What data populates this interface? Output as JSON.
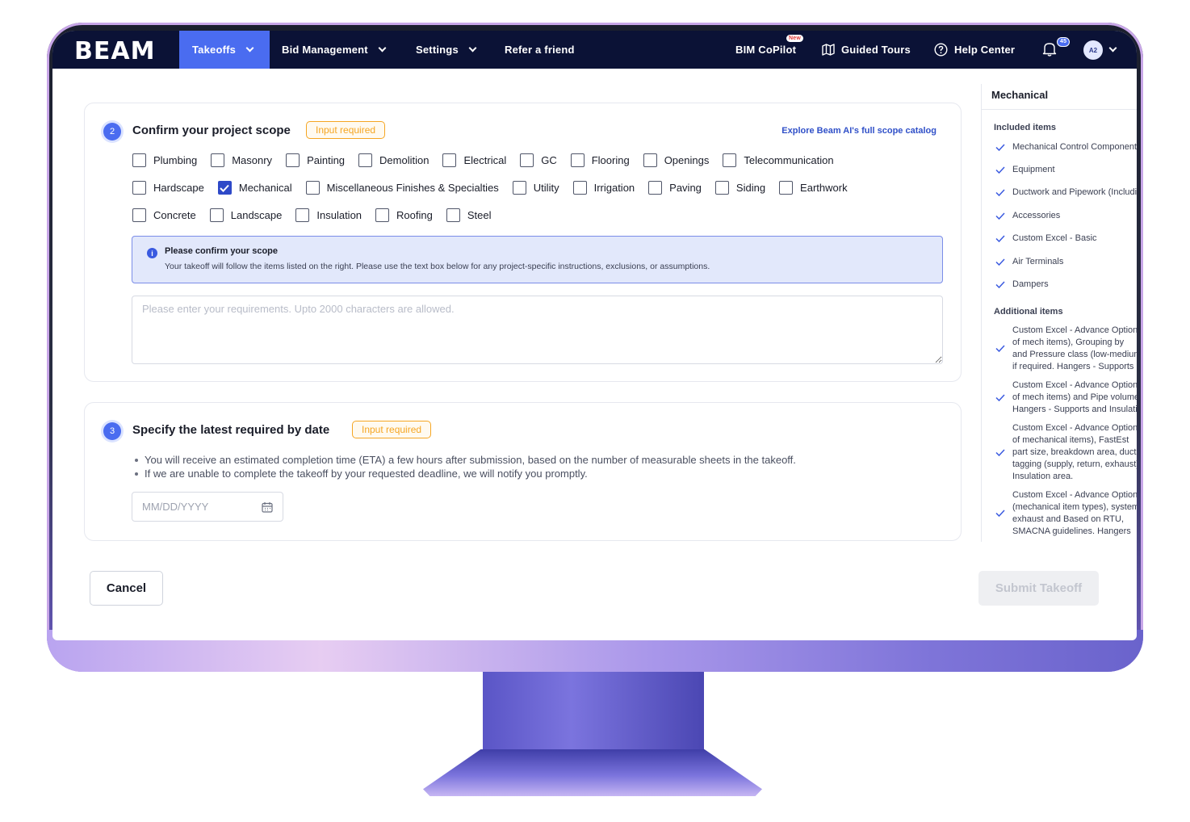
{
  "navbar": {
    "logo": "BEAM",
    "menu": [
      {
        "label": "Takeoffs"
      },
      {
        "label": "Bid Management"
      },
      {
        "label": "Settings"
      },
      {
        "label": "Refer a friend"
      }
    ],
    "bim_copilot": {
      "label": "BIM CoPilot",
      "badge": "New"
    },
    "guided_tours": "Guided Tours",
    "help_center": "Help Center",
    "notification_count": "45",
    "avatar_initials": "A2"
  },
  "scope": {
    "step": "2",
    "title": "Confirm your project scope",
    "badge": "Input required",
    "explore_link": "Explore Beam AI's full scope catalog",
    "rows": [
      [
        {
          "label": "Plumbing",
          "checked": false
        },
        {
          "label": "Masonry",
          "checked": false
        },
        {
          "label": "Painting",
          "checked": false
        },
        {
          "label": "Demolition",
          "checked": false
        },
        {
          "label": "Electrical",
          "checked": false
        },
        {
          "label": "GC",
          "checked": false
        },
        {
          "label": "Flooring",
          "checked": false
        },
        {
          "label": "Openings",
          "checked": false
        },
        {
          "label": "Telecommunication",
          "checked": false
        }
      ],
      [
        {
          "label": "Hardscape",
          "checked": false
        },
        {
          "label": "Mechanical",
          "checked": true
        },
        {
          "label": "Miscellaneous Finishes & Specialties",
          "checked": false
        },
        {
          "label": "Utility",
          "checked": false
        },
        {
          "label": "Irrigation",
          "checked": false
        },
        {
          "label": "Paving",
          "checked": false
        },
        {
          "label": "Siding",
          "checked": false
        },
        {
          "label": "Earthwork",
          "checked": false
        }
      ],
      [
        {
          "label": "Concrete",
          "checked": false
        },
        {
          "label": "Landscape",
          "checked": false
        },
        {
          "label": "Insulation",
          "checked": false
        },
        {
          "label": "Roofing",
          "checked": false
        },
        {
          "label": "Steel",
          "checked": false
        }
      ]
    ],
    "info_title": "Please confirm your scope",
    "info_text": "Your takeoff will follow the items listed on the right. Please use the text box below for any project-specific instructions, exclusions, or assumptions.",
    "textarea_placeholder": "Please enter your requirements. Upto 2000 characters are allowed.",
    "accent": "#4a6cf0",
    "badge_color": "#f5a623"
  },
  "date_section": {
    "step": "3",
    "title": "Specify the latest required by date",
    "badge": "Input required",
    "bullets": [
      "You will receive an estimated completion time (ETA) a few hours after submission, based on the number of measurable sheets in the takeoff.",
      "If we are unable to complete the takeoff by your requested deadline, we will notify you promptly."
    ],
    "date_placeholder": "MM/DD/YYYY"
  },
  "side_panel": {
    "title": "Mechanical",
    "included_label": "Included items",
    "included": [
      "Mechanical Control Components",
      "Equipment",
      "Ductwork and Pipework (Including Fittings)",
      "Accessories",
      "Custom Excel - Basic",
      "Air Terminals",
      "Dampers"
    ],
    "additional_label": "Additional items",
    "additional": [
      [
        "Custom Excel - Advance Option",
        "of mech items), Grouping by",
        "and Pressure class (low-medium",
        "if required. Hangers - Supports"
      ],
      [
        "Custom Excel - Advance Option",
        "of mech items) and Pipe volume",
        "Hangers - Supports and Insulation"
      ],
      [
        "Custom Excel - Advance Option",
        "of mechanical items), FastEst",
        "part size, breakdown area, duct",
        "tagging (supply, return, exhaust)",
        "Insulation area."
      ],
      [
        "Custom Excel - Advance Option",
        "(mechanical item types), system",
        "exhaust and Based on RTU,",
        "SMACNA guidelines. Hangers"
      ]
    ]
  },
  "footer": {
    "cancel": "Cancel",
    "submit": "Submit Takeoff"
  }
}
